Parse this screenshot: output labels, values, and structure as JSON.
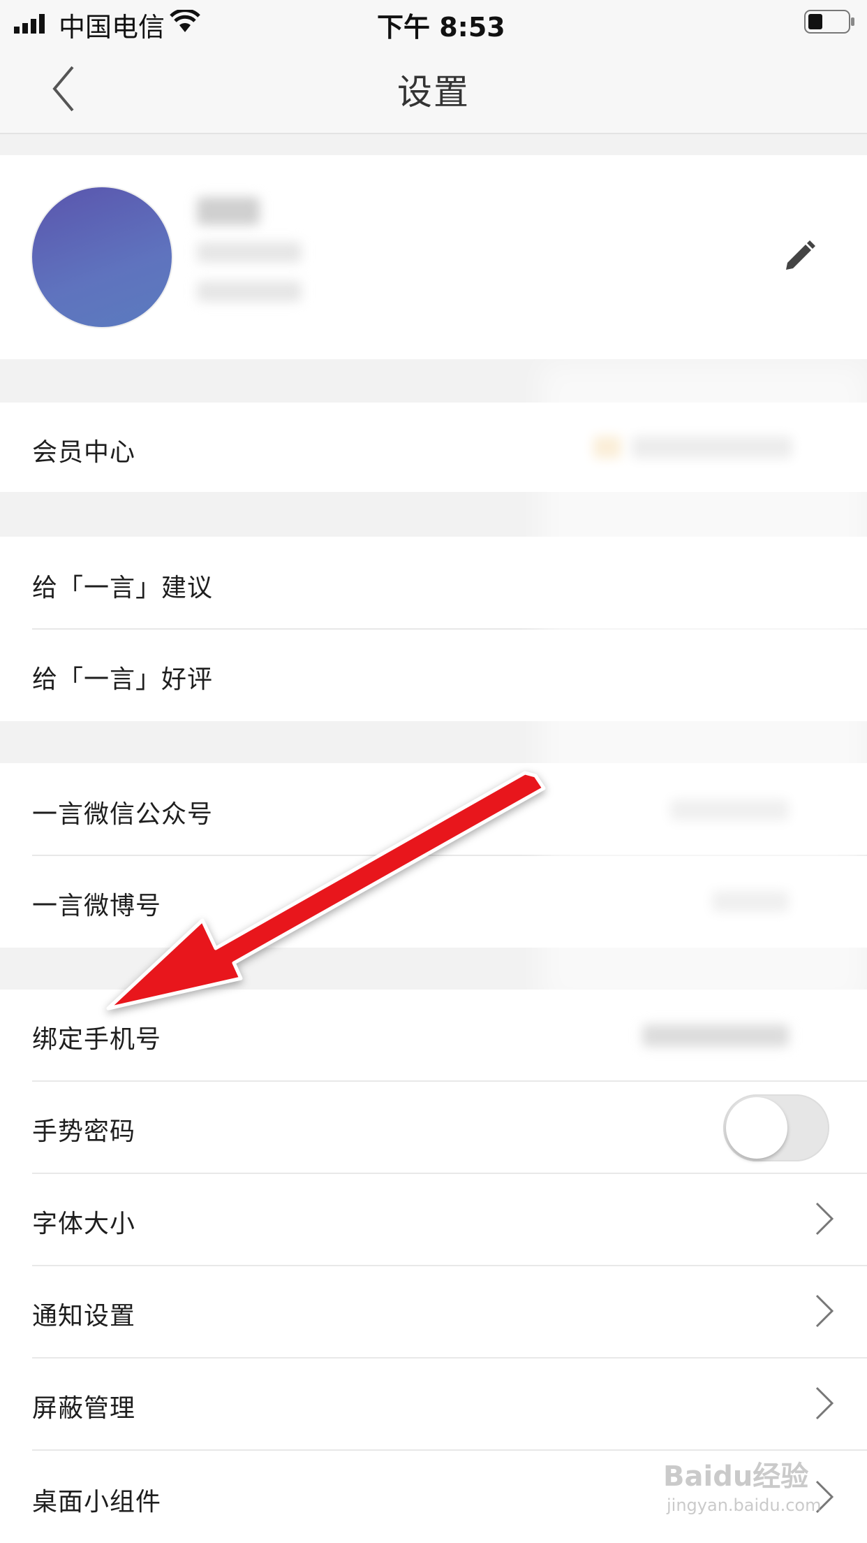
{
  "status_bar": {
    "carrier": "中国电信",
    "time": "下午 8:53"
  },
  "nav": {
    "title": "设置"
  },
  "settings": {
    "member_center": "会员中心",
    "suggest": "给「一言」建议",
    "review": "给「一言」好评",
    "wechat": "一言微信公众号",
    "weibo": "一言微博号",
    "bind_phone": "绑定手机号",
    "gesture_password": "手势密码",
    "font_size": "字体大小",
    "notification": "通知设置",
    "block_manage": "屏蔽管理",
    "widget": "桌面小组件"
  },
  "toggle": {
    "gesture_password_on": false
  },
  "watermark": {
    "brand": "Baidu经验",
    "url": "jingyan.baidu.com"
  },
  "colors": {
    "arrow": "#e8141b",
    "background": "#f2f2f2",
    "avatar": "#5a67b5"
  }
}
